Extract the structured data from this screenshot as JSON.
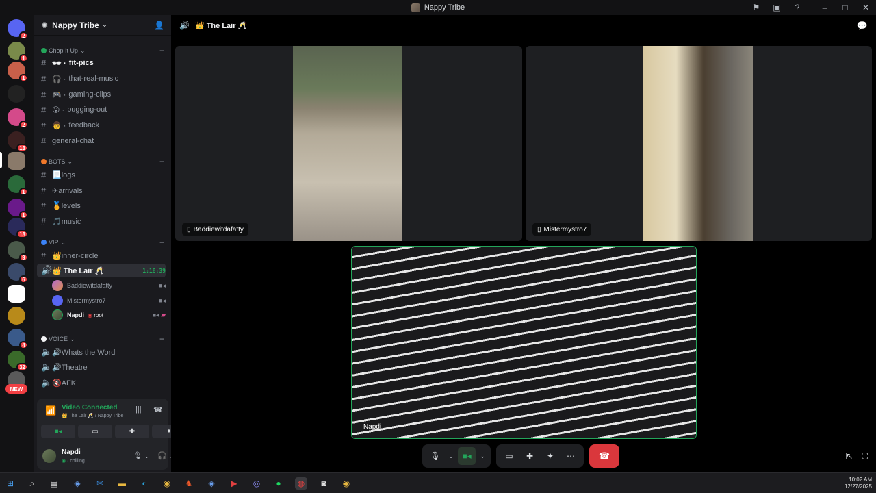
{
  "window": {
    "title": "Nappy Tribe"
  },
  "server": {
    "name": "Nappy Tribe"
  },
  "rail": {
    "badges": [
      "2",
      "1",
      "1",
      "2",
      "13",
      "1",
      "1",
      "13",
      "9",
      "6",
      "4",
      "32"
    ],
    "new_label": "NEW"
  },
  "categories": {
    "chop": "Chop It Up",
    "bots": "BOTS",
    "vip": "VIP",
    "voice": "VOICE"
  },
  "channels": {
    "fit_pics": "fit-pics",
    "real_music": "that-real-music",
    "gaming": "gaming-clips",
    "bugging": "bugging-out",
    "feedback": "feedback",
    "general": "general-chat",
    "logs": "📃logs",
    "arrivals": "✈arrivals",
    "levels": "🏅levels",
    "music": "🎵music",
    "inner": "👑inner-circle",
    "lair": "👑 The Lair 🥂",
    "lair_timer": "1:18:39",
    "whats": "🔊Whats the Word",
    "theatre": "🔊Theatre",
    "afk": "🔇AFK"
  },
  "voice_users": {
    "u1": "Baddiewitdafatty",
    "u2": "Mistermystro7",
    "u3": "Napdi",
    "u3_tag": "root"
  },
  "voice_panel": {
    "status": "Video Connected",
    "sub": "👑 The Lair 🥂 / Nappy Tribe"
  },
  "user_panel": {
    "name": "Napdi",
    "status": "chilling"
  },
  "call": {
    "channel": "👑 The Lair 🥂",
    "tiles": {
      "t1": "Baddiewitdafatty",
      "t2": "Mistermystro7",
      "t3": "Napdi"
    }
  },
  "clock": {
    "time": "10:02 AM",
    "date": "12/27/2025"
  },
  "colors": {
    "accent_green": "#23a55a",
    "hangup_red": "#da373c",
    "badge_red": "#f23f43"
  }
}
